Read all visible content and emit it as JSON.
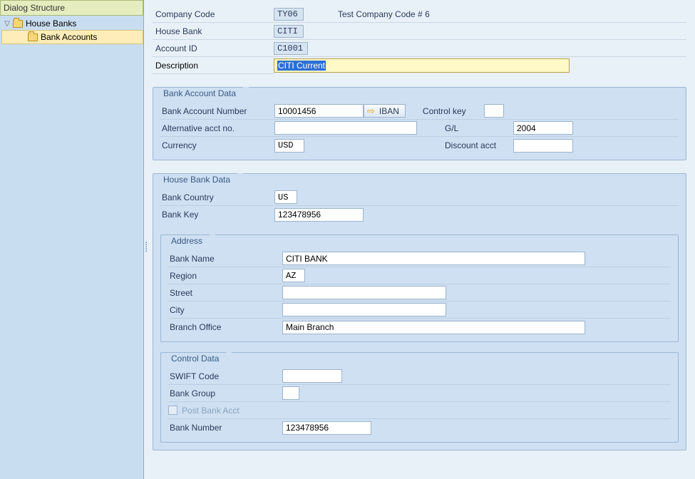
{
  "sidebar": {
    "title": "Dialog Structure",
    "node1": "House Banks",
    "node2": "Bank Accounts"
  },
  "header": {
    "company_code_label": "Company Code",
    "company_code": "TY06",
    "company_code_desc": "Test Company Code # 6",
    "house_bank_label": "House Bank",
    "house_bank": "CITI",
    "account_id_label": "Account ID",
    "account_id": "C1001",
    "description_label": "Description",
    "description": "CITI Current"
  },
  "bank_account_data": {
    "legend": "Bank Account Data",
    "bank_account_number_label": "Bank Account Number",
    "bank_account_number": "10001456",
    "iban_label": "IBAN",
    "control_key_label": "Control key",
    "control_key": "",
    "alt_acct_no_label": "Alternative acct no.",
    "alt_acct_no": "",
    "gl_label": "G/L",
    "gl": "2004",
    "currency_label": "Currency",
    "currency": "USD",
    "discount_acct_label": "Discount acct",
    "discount_acct": ""
  },
  "house_bank_data": {
    "legend": "House Bank Data",
    "bank_country_label": "Bank Country",
    "bank_country": "US",
    "bank_key_label": "Bank Key",
    "bank_key": "123478956"
  },
  "address": {
    "legend": "Address",
    "bank_name_label": "Bank Name",
    "bank_name": "CITI BANK",
    "region_label": "Region",
    "region": "AZ",
    "street_label": "Street",
    "street": "",
    "city_label": "City",
    "city": "",
    "branch_office_label": "Branch Office",
    "branch_office": "Main Branch"
  },
  "control_data": {
    "legend": "Control Data",
    "swift_code_label": "SWIFT Code",
    "swift_code": "",
    "bank_group_label": "Bank Group",
    "bank_group": "",
    "post_bank_acct_label": "Post Bank Acct",
    "bank_number_label": "Bank Number",
    "bank_number": "123478956"
  }
}
